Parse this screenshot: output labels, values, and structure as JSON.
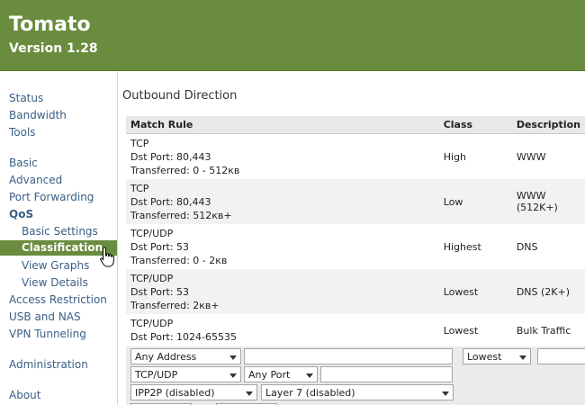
{
  "header": {
    "title": "Tomato",
    "version": "Version 1.28"
  },
  "sidebar": {
    "items": [
      {
        "label": "Status"
      },
      {
        "label": "Bandwidth"
      },
      {
        "label": "Tools"
      },
      {
        "label": "Basic"
      },
      {
        "label": "Advanced"
      },
      {
        "label": "Port Forwarding"
      },
      {
        "label": "QoS"
      },
      {
        "label": "Basic Settings"
      },
      {
        "label": "Classification"
      },
      {
        "label": "View Graphs"
      },
      {
        "label": "View Details"
      },
      {
        "label": "Access Restriction"
      },
      {
        "label": "USB and NAS"
      },
      {
        "label": "VPN Tunneling"
      },
      {
        "label": "Administration"
      },
      {
        "label": "About"
      }
    ],
    "selected": "Classification"
  },
  "main": {
    "section_title": "Outbound Direction",
    "table": {
      "headers": [
        "Match Rule",
        "Class",
        "Description"
      ],
      "rows": [
        {
          "proto": "TCP",
          "port": "Dst Port: 80,443",
          "transferred": "Transferred: 0 - 512кв",
          "class": "High",
          "description": "WWW"
        },
        {
          "proto": "TCP",
          "port": "Dst Port: 80,443",
          "transferred": "Transferred: 512кв+",
          "class": "Low",
          "description": "WWW (512K+)"
        },
        {
          "proto": "TCP/UDP",
          "port": "Dst Port: 53",
          "transferred": "Transferred: 0 - 2кв",
          "class": "Highest",
          "description": "DNS"
        },
        {
          "proto": "TCP/UDP",
          "port": "Dst Port: 53",
          "transferred": "Transferred: 2кв+",
          "class": "Lowest",
          "description": "DNS (2K+)"
        },
        {
          "proto": "TCP/UDP",
          "port": "Dst Port: 1024-65535",
          "transferred": "",
          "class": "Lowest",
          "description": "Bulk Traffic"
        }
      ]
    },
    "form": {
      "address_select": "Any Address",
      "protocol_select": "TCP/UDP",
      "port_select": "Any Port",
      "ipp2p_select": "IPP2P (disabled)",
      "layer7_select": "Layer 7 (disabled)",
      "class_select": "Lowest"
    }
  }
}
